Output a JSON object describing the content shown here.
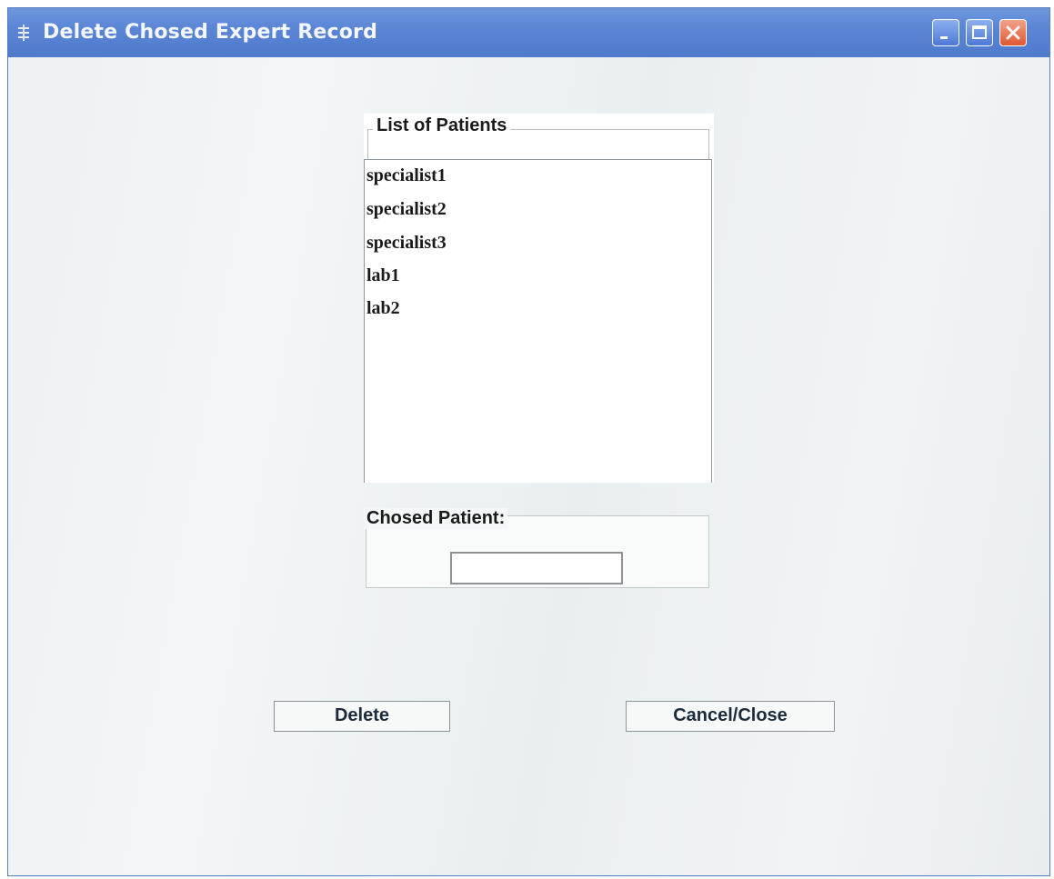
{
  "window": {
    "title": "Delete Chosed Expert Record",
    "controls": [
      "minimize-icon",
      "maximize-icon",
      "close-icon"
    ]
  },
  "list_panel": {
    "title": "List of Patients",
    "items": [
      {
        "label": "specialist1"
      },
      {
        "label": "specialist2"
      },
      {
        "label": "specialist3"
      },
      {
        "label": "lab1"
      },
      {
        "label": "lab2"
      }
    ]
  },
  "chosen_panel": {
    "title": "Chosed Patient:",
    "value": ""
  },
  "buttons": {
    "delete_label": "Delete",
    "cancel_label": "Cancel/Close"
  },
  "colors": {
    "titlebar": "#5b86d6",
    "close_button": "#e0572f",
    "button_text": "#1c2b3c"
  }
}
